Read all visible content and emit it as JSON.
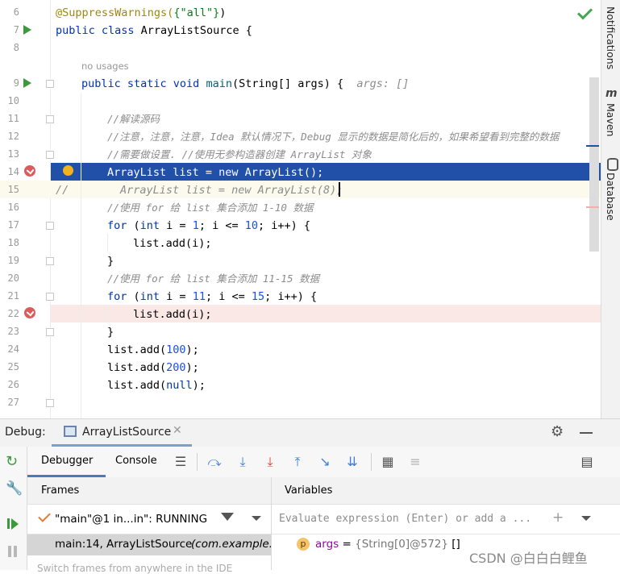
{
  "editor": {
    "line_numbers": [
      "6",
      "7",
      "8",
      "",
      "9",
      "10",
      "11",
      "12",
      "13",
      "14",
      "15",
      "16",
      "17",
      "18",
      "19",
      "20",
      "21",
      "22",
      "23",
      "24",
      "25",
      "26",
      "27"
    ],
    "usage_hint": "no usages",
    "param_hint": "args: []",
    "lines": {
      "l6_annotation": "@SuppressWarnings(",
      "l6_string": "{\"all\"}",
      "l6_close": ")",
      "l7_kw": "public class",
      "l7_rest": " ArrayListSource {",
      "l9_kw": "public static void",
      "l9_method": " main",
      "l9_rest": "(String[] args) {",
      "l11": "//解读源码",
      "l12": "//注意，注意，注意，Idea 默认情况下，Debug 显示的数据是简化后的，如果希望看到完整的数据",
      "l13": "//需要做设置. //使用无参构造器创建 ArrayList 对象",
      "l14": "ArrayList list = new ArrayList();",
      "l15_prefix": "//",
      "l15": "ArrayList list = new ArrayList(8);",
      "l16": "//使用 for 给 list 集合添加 1-10 数据",
      "l17_kw": "for",
      "l17_a": " (",
      "l17_int": "int",
      "l17_b": " i = ",
      "l17_n1": "1",
      "l17_c": "; i <= ",
      "l17_n2": "10",
      "l17_d": "; i++) {",
      "l18": "list.add(i);",
      "l19": "}",
      "l20": "//使用 for 给 list 集合添加 11-15 数据",
      "l21_kw": "for",
      "l21_a": " (",
      "l21_int": "int",
      "l21_b": " i = ",
      "l21_n1": "11",
      "l21_c": "; i <= ",
      "l21_n2": "15",
      "l21_d": "; i++) {",
      "l22": "list.add(i);",
      "l23": "}",
      "l24_a": "list.add(",
      "l24_n": "100",
      "l24_b": ");",
      "l25_a": "list.add(",
      "l25_n": "200",
      "l25_b": ");",
      "l26_a": "list.add(",
      "l26_kw": "null",
      "l26_b": ");"
    }
  },
  "right_sidebar": {
    "notifications": "Notifications",
    "maven": "Maven",
    "database": "Database"
  },
  "debug": {
    "title": "Debug:",
    "session_tab": "ArrayListSource",
    "tabs": {
      "debugger": "Debugger",
      "console": "Console"
    },
    "frames": {
      "title": "Frames",
      "thread": "\"main\"@1 in...in\": RUNNING",
      "frame_main": "main:14, ArrayListSource",
      "frame_pkg": "(com.example.c",
      "hint": "Switch frames from anywhere in the IDE"
    },
    "variables": {
      "title": "Variables",
      "eval_placeholder": "Evaluate expression (Enter) or add a ...",
      "var_badge": "p",
      "var_name": "args",
      "var_eq": " = ",
      "var_value": "{String[0]@572}",
      "var_extra": " []"
    }
  },
  "watermark": "CSDN @白白白鲤鱼",
  "colors": {
    "selection": "#2150a8",
    "breakpoint_line": "#fae8e6",
    "current_line": "#fcfaed",
    "run_green": "#3c9a3c",
    "breakpoint_red": "#db5c5c"
  }
}
